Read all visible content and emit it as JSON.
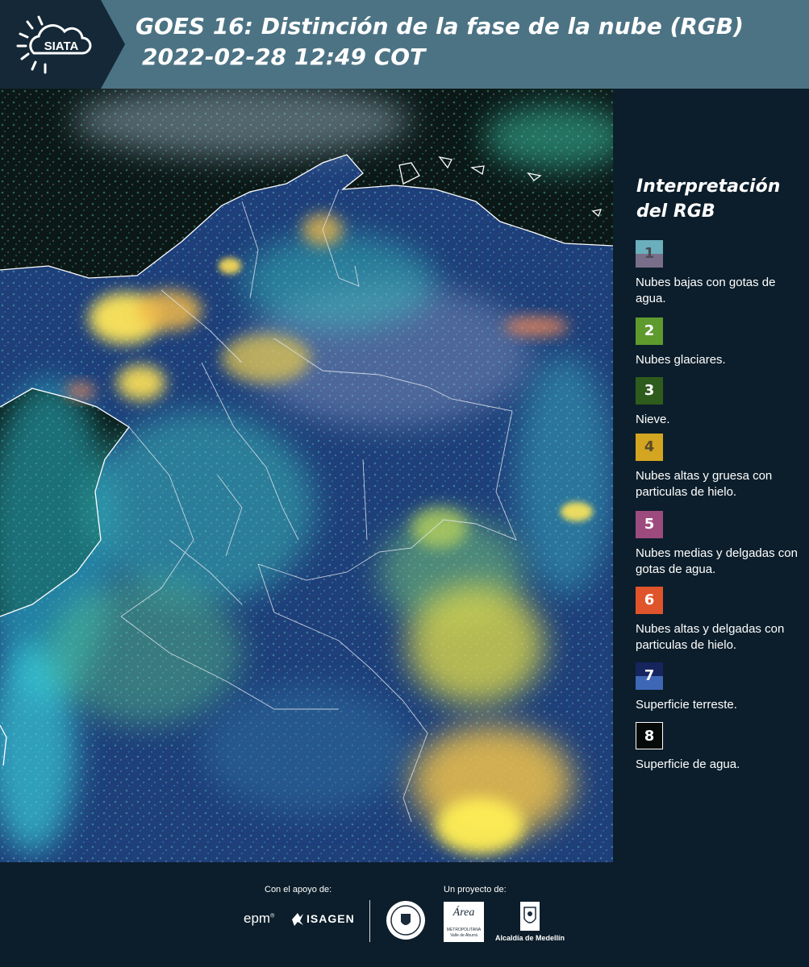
{
  "header": {
    "logo_text": "SIATA",
    "title_line1": "GOES 16: Distinción de la fase de la nube (RGB)",
    "title_line2": "2022-02-28 12:49 COT"
  },
  "legend": {
    "title_line1": "Interpretación",
    "title_line2": "del RGB",
    "items": [
      {
        "number": "1",
        "label": "Nubes bajas con gotas de agua.",
        "color_top": "#6bafbd",
        "color_bottom": "#7a6f8a",
        "text_color": "#4a4a55"
      },
      {
        "number": "2",
        "label": "Nubes glaciares.",
        "color": "#5e9a2e",
        "text_color": "#ffffff"
      },
      {
        "number": "3",
        "label": "Nieve.",
        "color": "#2e5c1d",
        "text_color": "#ffffff"
      },
      {
        "number": "4",
        "label": "Nubes altas y gruesa con particulas de hielo.",
        "color": "#d4a521",
        "text_color": "#5a4a2a"
      },
      {
        "number": "5",
        "label": "Nubes medias y delgadas con gotas de agua.",
        "color": "#9d4a7e",
        "text_color": "#ffffff"
      },
      {
        "number": "6",
        "label": "Nubes altas y delgadas con particulas de hielo.",
        "color": "#e0542b",
        "text_color": "#ffffff"
      },
      {
        "number": "7",
        "label": "Superficie terreste.",
        "color_top": "#16255e",
        "color_bottom": "#3e67b5",
        "text_color": "#ffffff"
      },
      {
        "number": "8",
        "label": "Superficie de agua.",
        "color": "#060a08",
        "text_color": "#ffffff"
      }
    ]
  },
  "footer": {
    "support_label": "Con el apoyo de:",
    "project_label": "Un proyecto de:",
    "epm_text": "epm",
    "isagen_text": "ISAGEN",
    "area_text": "Área",
    "area_sub1": "METROPOLITANA",
    "area_sub2": "Valle de Aburrá",
    "alcaldia_text": "Alcaldía de Medellín"
  },
  "colors": {
    "header_bg": "#4c7384",
    "logo_bg": "#142837",
    "page_bg": "#0c1e2b"
  }
}
